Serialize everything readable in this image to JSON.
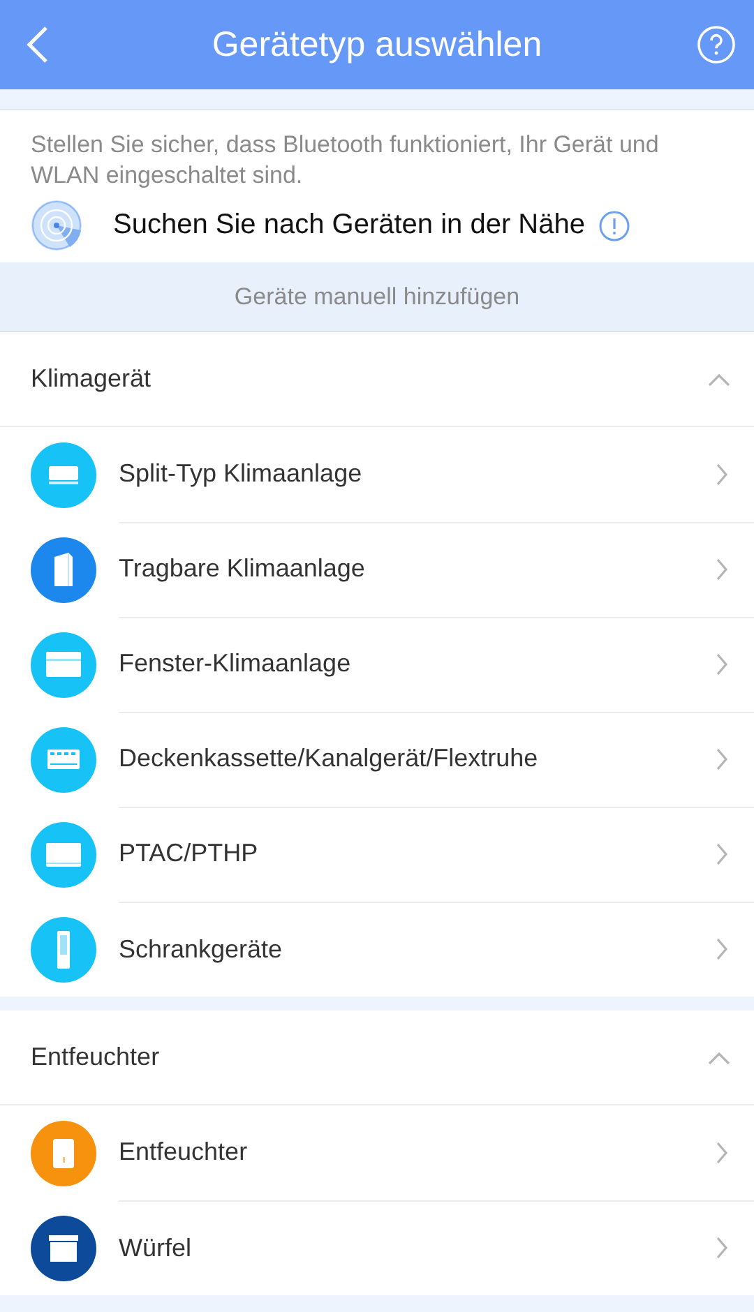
{
  "header": {
    "title": "Gerätetyp auswählen"
  },
  "notice": {
    "text": "Stellen Sie sicher, dass Bluetooth funktioniert, Ihr Gerät und WLAN eingeschaltet sind.",
    "scan_label": "Suchen Sie nach Geräten in der Nähe"
  },
  "manual_button": "Geräte manuell hinzufügen",
  "sections": [
    {
      "title": "Klimagerät",
      "expanded": true,
      "items": [
        {
          "label": "Split-Typ Klimaanlage",
          "kind": "split",
          "color": "#17c3f6"
        },
        {
          "label": "Tragbare Klimaanlage",
          "kind": "portable",
          "color": "#1c88ee"
        },
        {
          "label": "Fenster-Klimaanlage",
          "kind": "window",
          "color": "#17c3f6"
        },
        {
          "label": "Deckenkassette/Kanalgerät/Flextruhe",
          "kind": "cassette",
          "color": "#17c3f6"
        },
        {
          "label": "PTAC/PTHP",
          "kind": "ptac",
          "color": "#17c3f6"
        },
        {
          "label": "Schrankgeräte",
          "kind": "tower",
          "color": "#17c3f6"
        }
      ]
    },
    {
      "title": "Entfeuchter",
      "expanded": true,
      "items": [
        {
          "label": "Entfeuchter",
          "kind": "dehumidifier",
          "color": "#f7920f"
        },
        {
          "label": "Würfel",
          "kind": "cube",
          "color": "#0d4a9a"
        }
      ]
    }
  ]
}
